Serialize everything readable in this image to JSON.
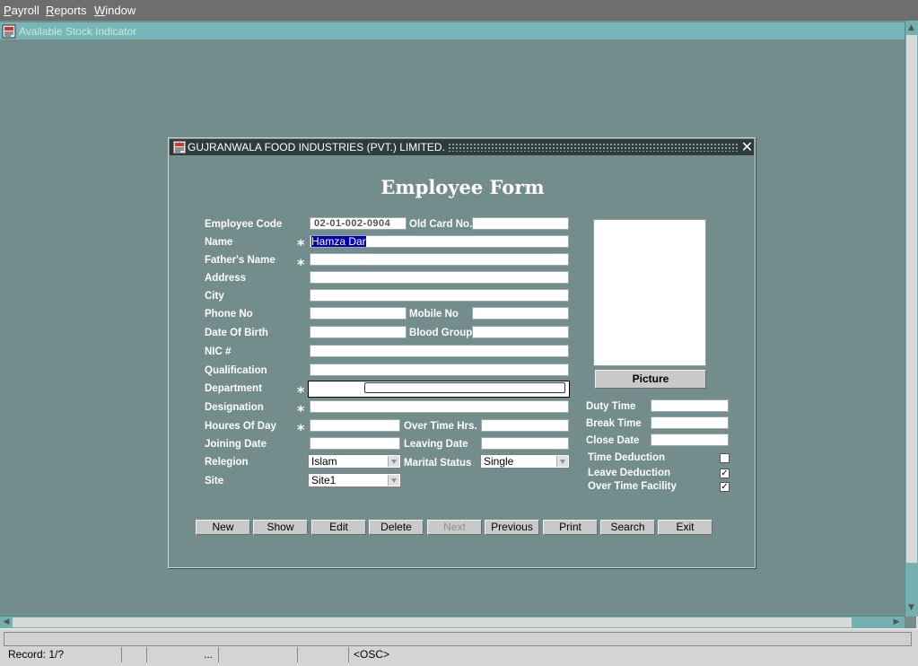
{
  "menubar": {
    "items": [
      {
        "first": "P",
        "rest": "ayroll"
      },
      {
        "first": "R",
        "rest": "eports"
      },
      {
        "first": "W",
        "rest": "indow"
      }
    ]
  },
  "mdi": {
    "title": "Available Stock Indicator"
  },
  "window": {
    "title": "GUJRANWALA FOOD INDUSTRIES (PVT.) LIMITED.",
    "close_glyph": "✕",
    "form_title": "Employee Form"
  },
  "labels": {
    "employee_code": "Employee Code",
    "old_card_no": "Old Card No.",
    "name": "Name",
    "fathers_name": "Father's Name",
    "address": "Address",
    "city": "City",
    "phone_no": "Phone No",
    "mobile_no": "Mobile No",
    "date_of_birth": "Date Of Birth",
    "blood_group": "Blood Group",
    "nic": "NIC #",
    "qualification": "Qualification",
    "department": "Department",
    "designation": "Designation",
    "houres_of_day": "Houres Of Day",
    "over_time_hrs": "Over Time Hrs.",
    "joining_date": "Joining Date",
    "leaving_date": "Leaving Date",
    "relegion": "Relegion",
    "marital_status": "Marital Status",
    "site": "Site",
    "duty_time": "Duty Time",
    "break_time": "Break Time",
    "close_date": "Close Date",
    "time_deduction": "Time Deduction",
    "leave_deduction": "Leave Deduction",
    "over_time_facility": "Over Time Facility",
    "required_mark": "*"
  },
  "values": {
    "employee_code": "02-01-002-0904",
    "old_card_no": "",
    "name": "Hamza Dar",
    "fathers_name": "",
    "address": "",
    "city": "",
    "phone_no": "",
    "mobile_no": "",
    "date_of_birth": "",
    "blood_group": "",
    "nic": "",
    "qualification": "",
    "department": "",
    "designation": "",
    "houres_of_day": "",
    "over_time_hrs": "",
    "joining_date": "",
    "leaving_date": "",
    "relegion": "Islam",
    "marital_status": "Single",
    "site": "Site1",
    "duty_time": "",
    "break_time": "",
    "close_date": "",
    "time_deduction": false,
    "leave_deduction": true,
    "over_time_facility": true
  },
  "picture_button": "Picture",
  "checkmark_glyph": "✓",
  "buttons": {
    "new": "New",
    "show": "Show",
    "edit": "Edit",
    "delete": "Delete",
    "next": "Next",
    "previous": "Previous",
    "print": "Print",
    "search": "Search",
    "exit": "Exit"
  },
  "status": {
    "record": "Record: 1/?",
    "cell_ellipsis": "...",
    "osc": "<OSC>"
  }
}
